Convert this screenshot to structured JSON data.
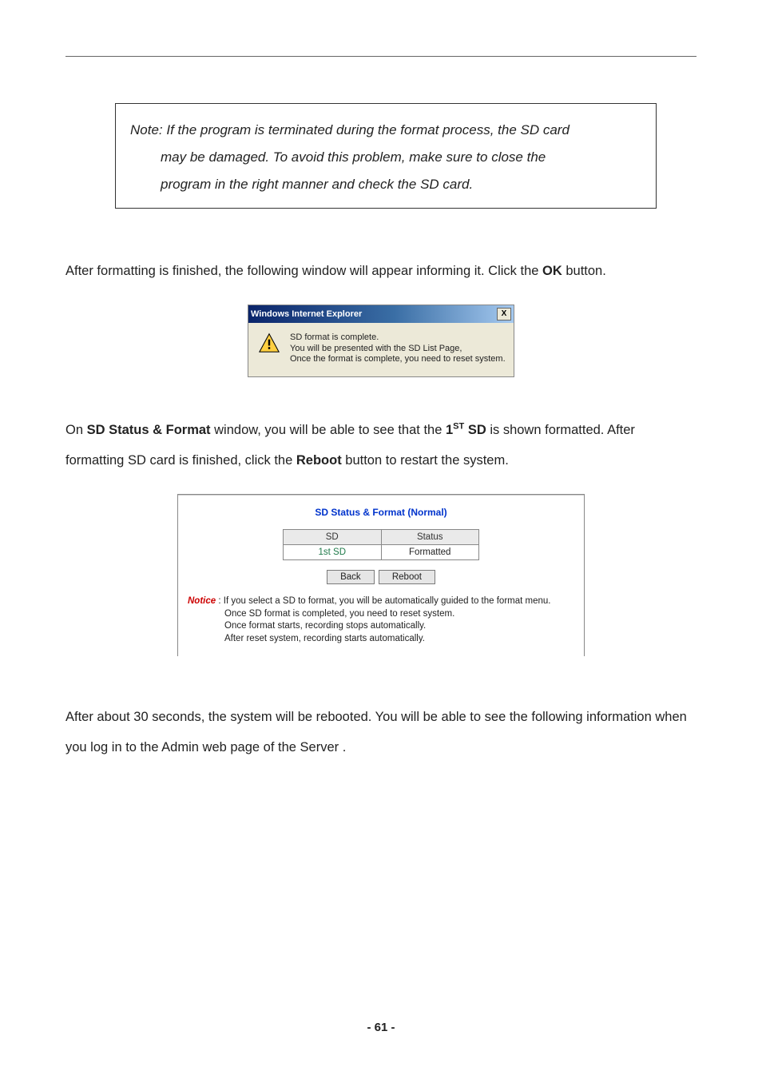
{
  "note": {
    "l1": "Note: If the program is terminated during the format process, the SD card",
    "l2": "may be damaged. To avoid this problem, make sure to close the",
    "l3": "program in the right manner and check the SD card."
  },
  "after_format": {
    "p1a": "After formatting is finished, the following window will appear informing it. Click the ",
    "ok": "OK",
    "p1b": " button."
  },
  "ie_dialog": {
    "title": "Windows Internet Explorer",
    "close": "X",
    "l1": "SD format is complete.",
    "l2": "You will be presented with the SD List Page,",
    "l3": "Once the format is complete, you need to reset system."
  },
  "status_para": {
    "a": "On ",
    "sd_status": "SD Status & Format",
    "b": " window, you will be able to see that the ",
    "first": "1",
    "first_sup": "ST",
    "sd": " SD",
    "c": " is shown formatted. After formatting SD card is finished, click the ",
    "reboot": "Reboot",
    "d": " button to restart the system."
  },
  "sd_panel": {
    "title": "SD Status & Format (Normal)",
    "headers": {
      "sd": "SD",
      "status": "Status"
    },
    "row": {
      "sd": "1st SD",
      "status": "Formatted"
    },
    "buttons": {
      "back": "Back",
      "reboot": "Reboot"
    },
    "notice_label": "Notice",
    "notice_colon": " : ",
    "n1": "If you select a SD to format, you will be automatically guided to the format menu.",
    "n2": "Once SD format is completed, you need to reset system.",
    "n3": "Once format starts, recording stops automatically.",
    "n4": "After reset system, recording starts automatically."
  },
  "after_reboot": "After about 30 seconds, the system will be rebooted. You will be able to see the following information when you log in to the Admin web page of the Server .",
  "pgnum": "- 61 -"
}
